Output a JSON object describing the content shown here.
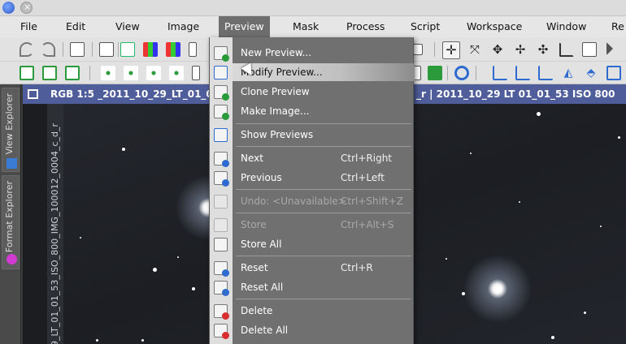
{
  "menubar": {
    "items": [
      {
        "label": "File"
      },
      {
        "label": "Edit"
      },
      {
        "label": "View"
      },
      {
        "label": "Image"
      },
      {
        "label": "Preview"
      },
      {
        "label": "Mask"
      },
      {
        "label": "Process"
      },
      {
        "label": "Script"
      },
      {
        "label": "Workspace"
      },
      {
        "label": "Window"
      },
      {
        "label": "Re"
      }
    ]
  },
  "dock": {
    "tabs": [
      {
        "label": "View Explorer",
        "swatch": "#3a7bd5"
      },
      {
        "label": "Format Explorer",
        "swatch": "#d13bd1"
      }
    ]
  },
  "image_window": {
    "title_left": "RGB 1:5 _2011_10_29_LT_01_0",
    "title_right": "_r | 2011_10_29 LT 01_01_53 ISO 800 IM",
    "vertical_id": "29_LT_01_01_53_ISO_800_IMG_100012_0004_c_d_r"
  },
  "preview_menu": {
    "items": [
      {
        "label": "New Preview...",
        "shortcut": "",
        "icon": "new-preview-icon"
      },
      {
        "label": "Modify Preview...",
        "shortcut": "",
        "icon": "modify-preview-icon"
      },
      {
        "label": "Clone Preview",
        "shortcut": "",
        "icon": "clone-preview-icon"
      },
      {
        "label": "Make Image...",
        "shortcut": "",
        "icon": "make-image-icon"
      },
      {
        "label": "Show Previews",
        "shortcut": "",
        "icon": "show-previews-icon"
      },
      {
        "label": "Next",
        "shortcut": "Ctrl+Right",
        "icon": "next-icon"
      },
      {
        "label": "Previous",
        "shortcut": "Ctrl+Left",
        "icon": "previous-icon"
      },
      {
        "label": "Undo: <Unavailable>",
        "shortcut": "Ctrl+Shift+Z",
        "icon": "undo-icon"
      },
      {
        "label": "Store",
        "shortcut": "Ctrl+Alt+S",
        "icon": "store-icon"
      },
      {
        "label": "Store All",
        "shortcut": "",
        "icon": "store-all-icon"
      },
      {
        "label": "Reset",
        "shortcut": "Ctrl+R",
        "icon": "reset-icon"
      },
      {
        "label": "Reset All",
        "shortcut": "",
        "icon": "reset-all-icon"
      },
      {
        "label": "Delete",
        "shortcut": "",
        "icon": "delete-icon"
      },
      {
        "label": "Delete All",
        "shortcut": "",
        "icon": "delete-all-icon"
      }
    ]
  },
  "colors": {
    "menu_bg": "#707070",
    "title_blue": "#4f5e9a",
    "delete_badge": "#d9302f",
    "preview_badge": "#2b9a3a"
  }
}
